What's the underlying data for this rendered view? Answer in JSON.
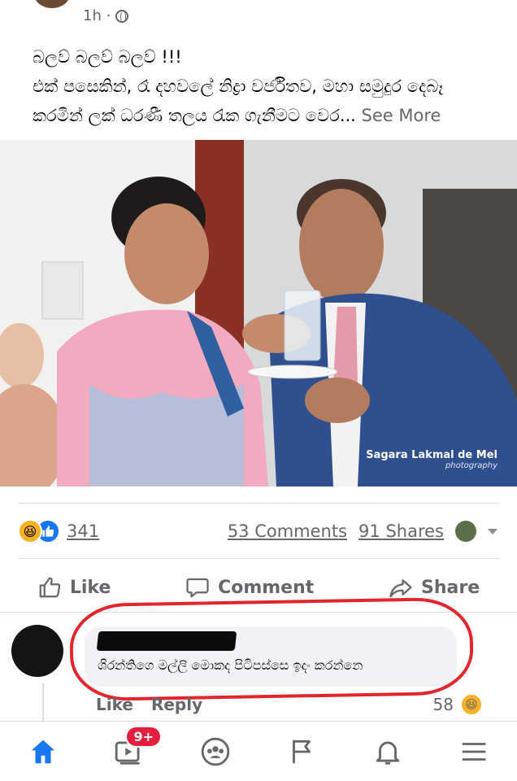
{
  "post": {
    "time": "1h ·",
    "text_lines": [
      "බලව් බලව් බලව් !!!",
      "එක් පසෙකින්, රෑ දහවලේ නිද්‍රා වර්ජිතව, මහා සමුදුර දෙබෑ",
      "කරමින් ලක් ධරණී තලය රැක ගැනීමට වෙර..."
    ],
    "see_more": "See More",
    "photo_credit": "Sagara Lakmal de Mel",
    "photo_credit_sub": "photography"
  },
  "stats": {
    "reaction_count": "341",
    "comments": "53 Comments",
    "shares": "91 Shares"
  },
  "actions": {
    "like": "Like",
    "comment": "Comment",
    "share": "Share"
  },
  "comment": {
    "text": "ශිරන්තිගෙ මල්ලි මොකද පිටිපස්සෙ ඉදං කරන්නෙ",
    "like": "Like",
    "reply": "Reply",
    "reaction_count": "58"
  },
  "tabbar": {
    "video_badge": "9+"
  },
  "colors": {
    "accent": "#1877f2",
    "badge": "#e41e3f",
    "highlight": "#e4252e",
    "muted": "#65676b"
  }
}
